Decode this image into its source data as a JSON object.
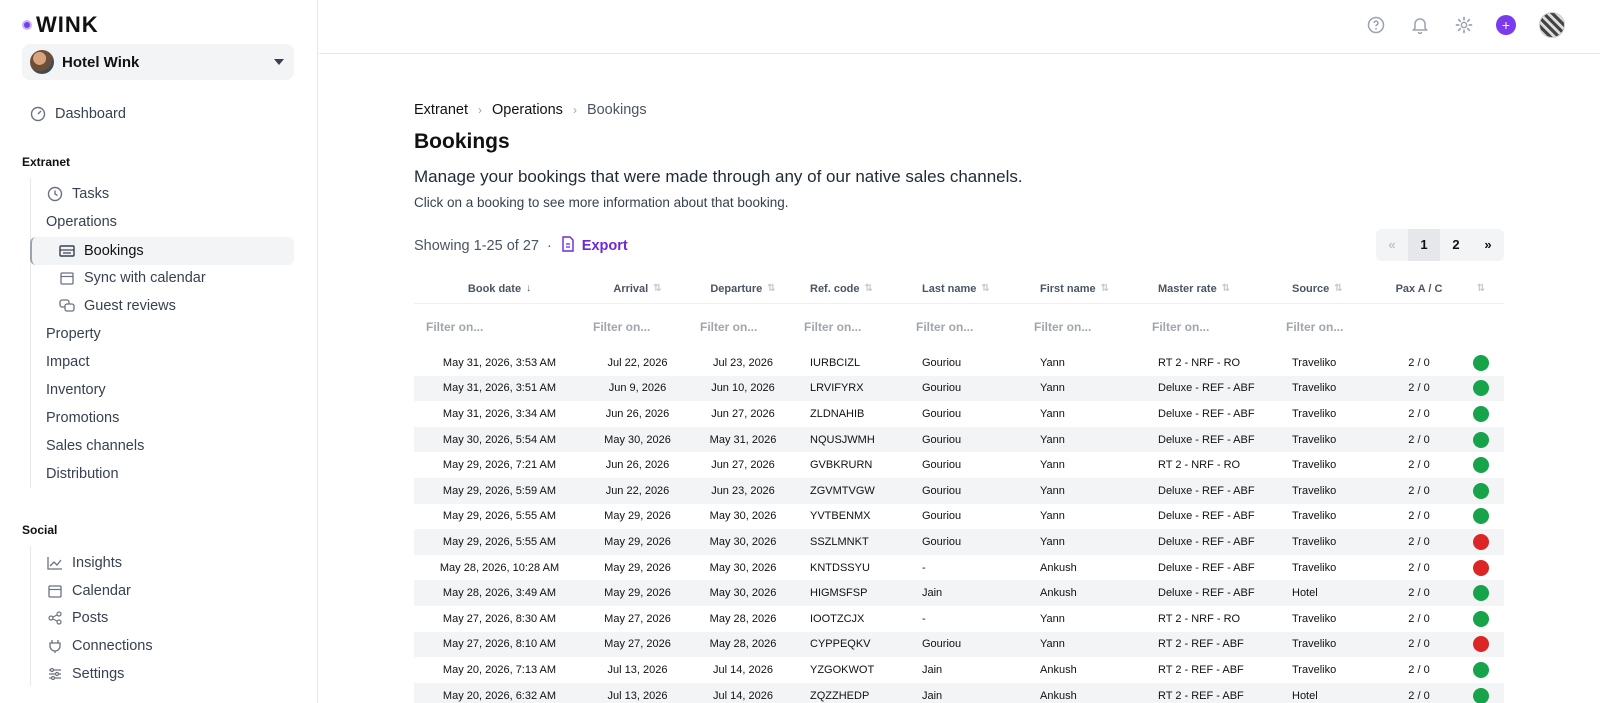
{
  "app": {
    "logo_text": "WINK"
  },
  "hotel": {
    "name": "Hotel Wink"
  },
  "sidebar": {
    "dashboard": "Dashboard",
    "extranet_title": "Extranet",
    "extranet": {
      "tasks": "Tasks",
      "operations": "Operations",
      "bookings": "Bookings",
      "sync": "Sync with calendar",
      "reviews": "Guest reviews",
      "property": "Property",
      "impact": "Impact",
      "inventory": "Inventory",
      "promotions": "Promotions",
      "sales_channels": "Sales channels",
      "distribution": "Distribution"
    },
    "social_title": "Social",
    "social": {
      "insights": "Insights",
      "calendar": "Calendar",
      "posts": "Posts",
      "connections": "Connections",
      "settings": "Settings"
    }
  },
  "breadcrumb": [
    "Extranet",
    "Operations",
    "Bookings"
  ],
  "page": {
    "title": "Bookings",
    "description": "Manage your bookings that were made through any of our native sales channels.",
    "hint": "Click on a booking to see more information about that booking.",
    "showing": "Showing 1-25 of 27",
    "separator": "·",
    "export": "Export"
  },
  "pagination": {
    "prev": "«",
    "pages": [
      "1",
      "2"
    ],
    "next": "»",
    "current": "1"
  },
  "colors": {
    "accent": "#6d28d9",
    "status_green": "#16a34a",
    "status_red": "#dc2626"
  },
  "table": {
    "columns": [
      "Book date",
      "Arrival",
      "Departure",
      "Ref. code",
      "Last name",
      "First name",
      "Master rate",
      "Source",
      "Pax A / C"
    ],
    "filter_placeholder": "Filter on...",
    "rows": [
      {
        "book_date": "May 31, 2026, 3:53 AM",
        "arrival": "Jul 22, 2026",
        "departure": "Jul 23, 2026",
        "ref": "IURBCIZL",
        "last": "Gouriou",
        "first": "Yann",
        "rate": "RT 2 - NRF - RO",
        "source": "Traveliko",
        "pax": "2 / 0",
        "status": "green"
      },
      {
        "book_date": "May 31, 2026, 3:51 AM",
        "arrival": "Jun 9, 2026",
        "departure": "Jun 10, 2026",
        "ref": "LRVIFYRX",
        "last": "Gouriou",
        "first": "Yann",
        "rate": "Deluxe - REF - ABF",
        "source": "Traveliko",
        "pax": "2 / 0",
        "status": "green"
      },
      {
        "book_date": "May 31, 2026, 3:34 AM",
        "arrival": "Jun 26, 2026",
        "departure": "Jun 27, 2026",
        "ref": "ZLDNAHIB",
        "last": "Gouriou",
        "first": "Yann",
        "rate": "Deluxe - REF - ABF",
        "source": "Traveliko",
        "pax": "2 / 0",
        "status": "green"
      },
      {
        "book_date": "May 30, 2026, 5:54 AM",
        "arrival": "May 30, 2026",
        "departure": "May 31, 2026",
        "ref": "NQUSJWMH",
        "last": "Gouriou",
        "first": "Yann",
        "rate": "Deluxe - REF - ABF",
        "source": "Traveliko",
        "pax": "2 / 0",
        "status": "green"
      },
      {
        "book_date": "May 29, 2026, 7:21 AM",
        "arrival": "Jun 26, 2026",
        "departure": "Jun 27, 2026",
        "ref": "GVBKRURN",
        "last": "Gouriou",
        "first": "Yann",
        "rate": "RT 2 - NRF - RO",
        "source": "Traveliko",
        "pax": "2 / 0",
        "status": "green"
      },
      {
        "book_date": "May 29, 2026, 5:59 AM",
        "arrival": "Jun 22, 2026",
        "departure": "Jun 23, 2026",
        "ref": "ZGVMTVGW",
        "last": "Gouriou",
        "first": "Yann",
        "rate": "Deluxe - REF - ABF",
        "source": "Traveliko",
        "pax": "2 / 0",
        "status": "green"
      },
      {
        "book_date": "May 29, 2026, 5:55 AM",
        "arrival": "May 29, 2026",
        "departure": "May 30, 2026",
        "ref": "YVTBENMX",
        "last": "Gouriou",
        "first": "Yann",
        "rate": "Deluxe - REF - ABF",
        "source": "Traveliko",
        "pax": "2 / 0",
        "status": "green"
      },
      {
        "book_date": "May 29, 2026, 5:55 AM",
        "arrival": "May 29, 2026",
        "departure": "May 30, 2026",
        "ref": "SSZLMNKT",
        "last": "Gouriou",
        "first": "Yann",
        "rate": "Deluxe - REF - ABF",
        "source": "Traveliko",
        "pax": "2 / 0",
        "status": "red"
      },
      {
        "book_date": "May 28, 2026, 10:28 AM",
        "arrival": "May 29, 2026",
        "departure": "May 30, 2026",
        "ref": "KNTDSSYU",
        "last": "-",
        "first": "Ankush",
        "rate": "Deluxe - REF - ABF",
        "source": "Traveliko",
        "pax": "2 / 0",
        "status": "red"
      },
      {
        "book_date": "May 28, 2026, 3:49 AM",
        "arrival": "May 29, 2026",
        "departure": "May 30, 2026",
        "ref": "HIGMSFSP",
        "last": "Jain",
        "first": "Ankush",
        "rate": "Deluxe - REF - ABF",
        "source": "Hotel",
        "pax": "2 / 0",
        "status": "green"
      },
      {
        "book_date": "May 27, 2026, 8:30 AM",
        "arrival": "May 27, 2026",
        "departure": "May 28, 2026",
        "ref": "IOOTZCJX",
        "last": "-",
        "first": "Yann",
        "rate": "RT 2 - NRF - RO",
        "source": "Traveliko",
        "pax": "2 / 0",
        "status": "green"
      },
      {
        "book_date": "May 27, 2026, 8:10 AM",
        "arrival": "May 27, 2026",
        "departure": "May 28, 2026",
        "ref": "CYPPEQKV",
        "last": "Gouriou",
        "first": "Yann",
        "rate": "RT 2 - REF - ABF",
        "source": "Traveliko",
        "pax": "2 / 0",
        "status": "red"
      },
      {
        "book_date": "May 20, 2026, 7:13 AM",
        "arrival": "Jul 13, 2026",
        "departure": "Jul 14, 2026",
        "ref": "YZGOKWOT",
        "last": "Jain",
        "first": "Ankush",
        "rate": "RT 2 - REF - ABF",
        "source": "Traveliko",
        "pax": "2 / 0",
        "status": "green"
      },
      {
        "book_date": "May 20, 2026, 6:32 AM",
        "arrival": "Jul 13, 2026",
        "departure": "Jul 14, 2026",
        "ref": "ZQZZHEDP",
        "last": "Jain",
        "first": "Ankush",
        "rate": "RT 2 - REF - ABF",
        "source": "Hotel",
        "pax": "2 / 0",
        "status": "green"
      }
    ]
  }
}
